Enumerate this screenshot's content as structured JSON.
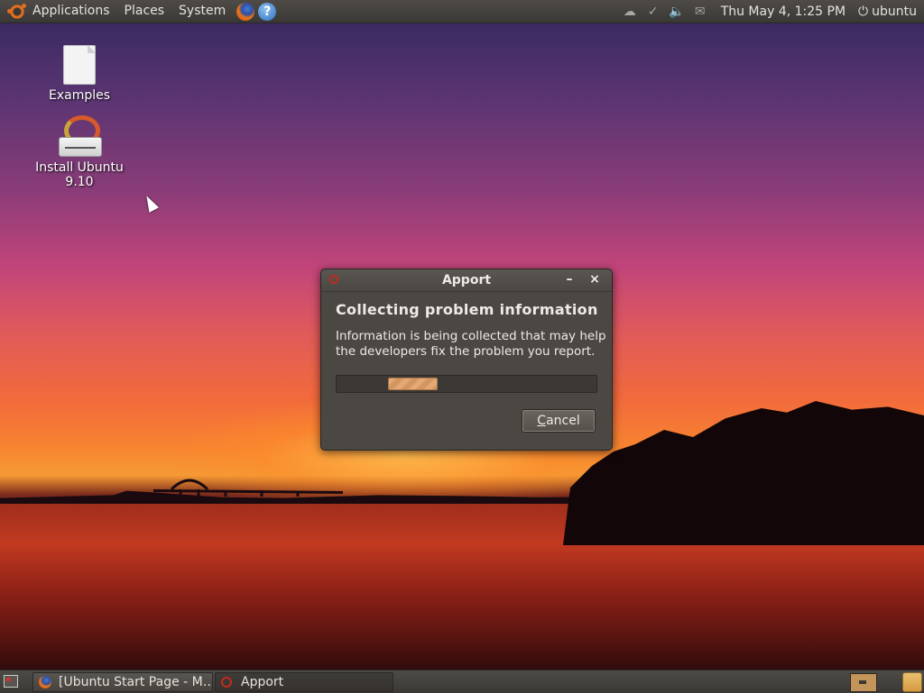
{
  "top_panel": {
    "menus": [
      "Applications",
      "Places",
      "System"
    ],
    "clock": "Thu May  4,  1:25 PM",
    "user": "ubuntu"
  },
  "desktop": {
    "icons": [
      {
        "label": "Examples"
      },
      {
        "label": "Install Ubuntu 9.10"
      }
    ]
  },
  "dialog": {
    "title": "Apport",
    "heading": "Collecting problem information",
    "message": "Information is being collected that may help the developers fix the problem you report.",
    "cancel_label": "Cancel",
    "minimize_glyph": "–",
    "close_glyph": "×"
  },
  "taskbar": {
    "tasks": [
      {
        "label": "[Ubuntu Start Page - M…",
        "icon": "firefox-icon"
      },
      {
        "label": "Apport",
        "icon": "apport-icon"
      }
    ]
  },
  "colors": {
    "panel": "#3a3835",
    "dialog_bg": "#4b4743",
    "progress_pulse": "#e2a875",
    "accent_orange": "#e06d20"
  }
}
